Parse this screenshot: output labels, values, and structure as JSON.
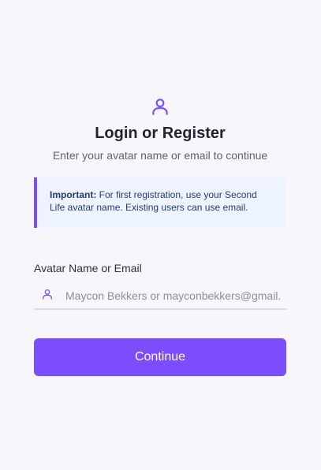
{
  "header": {
    "icon": "user-icon",
    "title": "Login or Register",
    "subtitle": "Enter your avatar name or email to continue"
  },
  "notice": {
    "strong": "Important:",
    "text": " For first registration, use your Second Life avatar name. Existing users can use email."
  },
  "form": {
    "label": "Avatar Name or Email",
    "input_icon": "user-icon",
    "placeholder": "Maycon Bekkers or mayconbekkers@gmail.com",
    "value": ""
  },
  "button": {
    "label": "Continue"
  },
  "colors": {
    "accent": "#7c4dff",
    "background": "#f6f6fb",
    "notice_bg": "#eef4ff"
  }
}
